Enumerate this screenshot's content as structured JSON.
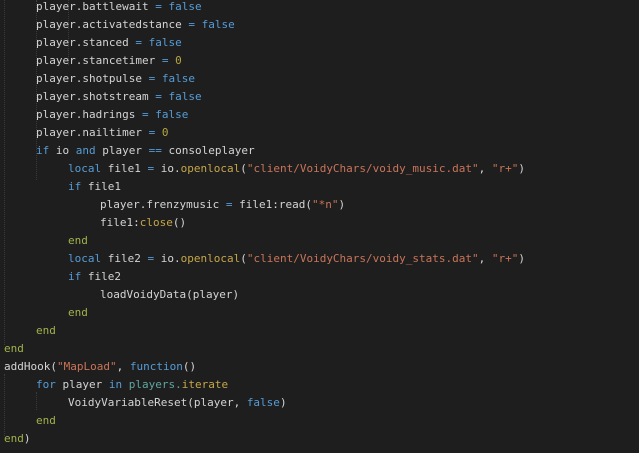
{
  "editor": {
    "language": "Lua",
    "theme": {
      "background": "#1e1e1e",
      "identifier": "#d4d4d4",
      "operator": "#569cd6",
      "keyword": "#569cd6",
      "boolean": "#569cd6",
      "number": "#b5a642",
      "string": "#c8745a",
      "function_call": "#c6a648",
      "library": "#5fa7a0",
      "end_keyword": "#a0b24a"
    },
    "lines": [
      {
        "indent": 1,
        "tokens": [
          [
            "player.battlewait",
            "ident"
          ],
          [
            " = ",
            "op"
          ],
          [
            "false",
            "bool"
          ]
        ]
      },
      {
        "indent": 1,
        "tokens": [
          [
            "player.activatedstance",
            "ident"
          ],
          [
            " = ",
            "op"
          ],
          [
            "false",
            "bool"
          ]
        ]
      },
      {
        "indent": 1,
        "tokens": [
          [
            "player.stanced",
            "ident"
          ],
          [
            " = ",
            "op"
          ],
          [
            "false",
            "bool"
          ]
        ]
      },
      {
        "indent": 1,
        "tokens": [
          [
            "player.stancetimer",
            "ident"
          ],
          [
            " = ",
            "op"
          ],
          [
            "0",
            "number"
          ]
        ]
      },
      {
        "indent": 1,
        "tokens": [
          [
            "player.shotpulse",
            "ident"
          ],
          [
            " = ",
            "op"
          ],
          [
            "false",
            "bool"
          ]
        ]
      },
      {
        "indent": 1,
        "tokens": [
          [
            "player.shotstream",
            "ident"
          ],
          [
            " = ",
            "op"
          ],
          [
            "false",
            "bool"
          ]
        ]
      },
      {
        "indent": 1,
        "tokens": [
          [
            "player.hadrings",
            "ident"
          ],
          [
            " = ",
            "op"
          ],
          [
            "false",
            "bool"
          ]
        ]
      },
      {
        "indent": 1,
        "tokens": [
          [
            "player.nailtimer",
            "ident"
          ],
          [
            " = ",
            "op"
          ],
          [
            "0",
            "number"
          ]
        ]
      },
      {
        "indent": 1,
        "tokens": [
          [
            "if",
            "keyword"
          ],
          [
            " ",
            "ident"
          ],
          [
            "io",
            "ident"
          ],
          [
            " ",
            "ident"
          ],
          [
            "and",
            "keyword"
          ],
          [
            " player ",
            "ident"
          ],
          [
            "==",
            "op"
          ],
          [
            " consoleplayer",
            "ident"
          ]
        ]
      },
      {
        "indent": 2,
        "tokens": [
          [
            "local",
            "keyword"
          ],
          [
            " file1 ",
            "ident"
          ],
          [
            "=",
            "op"
          ],
          [
            " io.",
            "ident"
          ],
          [
            "openlocal",
            "func"
          ],
          [
            "(",
            "punct"
          ],
          [
            "\"client/VoidyChars/voidy_music.dat\"",
            "string"
          ],
          [
            ", ",
            "punct"
          ],
          [
            "\"r+\"",
            "string"
          ],
          [
            ")",
            "punct"
          ]
        ]
      },
      {
        "indent": 2,
        "tokens": [
          [
            "if",
            "keyword"
          ],
          [
            " file1",
            "ident"
          ]
        ]
      },
      {
        "indent": 3,
        "tokens": [
          [
            "player.frenzymusic ",
            "ident"
          ],
          [
            "=",
            "op"
          ],
          [
            " file1:read(",
            "ident"
          ],
          [
            "\"*n\"",
            "string"
          ],
          [
            ")",
            "punct"
          ]
        ]
      },
      {
        "indent": 3,
        "tokens": [
          [
            "file1:",
            "ident"
          ],
          [
            "close",
            "func"
          ],
          [
            "()",
            "punct"
          ]
        ]
      },
      {
        "indent": 2,
        "tokens": [
          [
            "end",
            "end"
          ]
        ]
      },
      {
        "indent": 2,
        "tokens": [
          [
            "local",
            "keyword"
          ],
          [
            " file2 ",
            "ident"
          ],
          [
            "=",
            "op"
          ],
          [
            " io.",
            "ident"
          ],
          [
            "openlocal",
            "func"
          ],
          [
            "(",
            "punct"
          ],
          [
            "\"client/VoidyChars/voidy_stats.dat\"",
            "string"
          ],
          [
            ", ",
            "punct"
          ],
          [
            "\"r+\"",
            "string"
          ],
          [
            ")",
            "punct"
          ]
        ]
      },
      {
        "indent": 2,
        "tokens": [
          [
            "if",
            "keyword"
          ],
          [
            " file2",
            "ident"
          ]
        ]
      },
      {
        "indent": 3,
        "tokens": [
          [
            "loadVoidyData(player)",
            "ident"
          ]
        ]
      },
      {
        "indent": 2,
        "tokens": [
          [
            "end",
            "end"
          ]
        ]
      },
      {
        "indent": 1,
        "tokens": [
          [
            "end",
            "end"
          ]
        ]
      },
      {
        "indent": 0,
        "tokens": [
          [
            "end",
            "end"
          ]
        ]
      },
      {
        "indent": 0,
        "tokens": [
          [
            "addHook(",
            "ident"
          ],
          [
            "\"MapLoad\"",
            "string"
          ],
          [
            ", ",
            "punct"
          ],
          [
            "function",
            "fn"
          ],
          [
            "()",
            "punct"
          ]
        ]
      },
      {
        "indent": 1,
        "tokens": [
          [
            "for",
            "keyword"
          ],
          [
            " player ",
            "ident"
          ],
          [
            "in",
            "keyword"
          ],
          [
            " ",
            "ident"
          ],
          [
            "players.",
            "lib"
          ],
          [
            "iterate",
            "func"
          ]
        ]
      },
      {
        "indent": 2,
        "tokens": [
          [
            "VoidyVariableReset(player, ",
            "ident"
          ],
          [
            "false",
            "bool"
          ],
          [
            ")",
            "punct"
          ]
        ]
      },
      {
        "indent": 1,
        "tokens": [
          [
            "end",
            "end"
          ]
        ]
      },
      {
        "indent": 0,
        "tokens": [
          [
            "end",
            "end"
          ],
          [
            ")",
            "punct"
          ]
        ]
      }
    ]
  }
}
